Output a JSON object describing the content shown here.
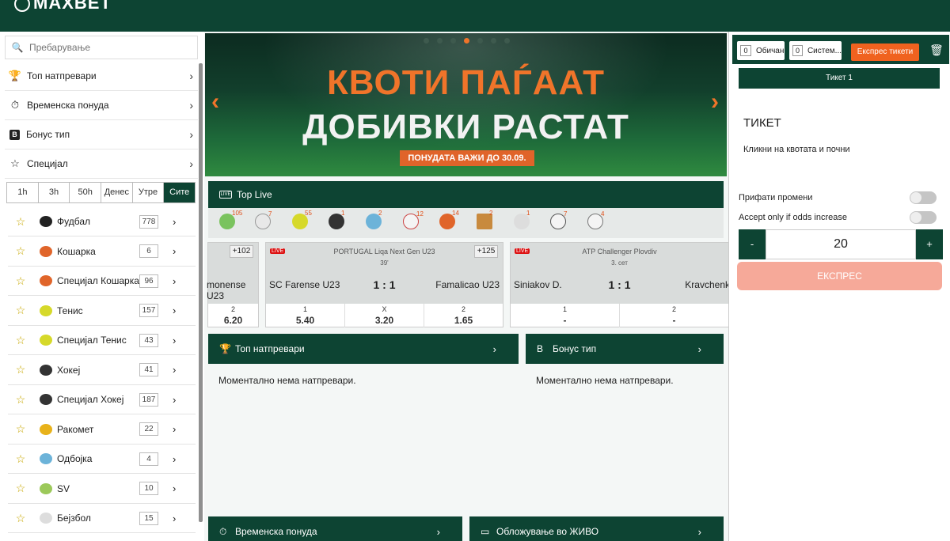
{
  "logo_text": "MAXBET",
  "search": {
    "placeholder": "Пребарување"
  },
  "menu": [
    {
      "label": "Топ натпревари",
      "icon": "trophy-icon",
      "glyph": "🏆"
    },
    {
      "label": "Временска понуда",
      "icon": "clock-icon",
      "glyph": "⏱"
    },
    {
      "label": "Бонус тип",
      "icon": "bonus-icon",
      "glyph": "B"
    },
    {
      "label": "Специјал",
      "icon": "star-icon",
      "glyph": "☆"
    }
  ],
  "time_tabs": [
    "1h",
    "3h",
    "50h",
    "Денес",
    "Утре",
    "Сите"
  ],
  "sports": [
    {
      "label": "Фудбал",
      "count": "778",
      "color": "#222222"
    },
    {
      "label": "Кошарка",
      "count": "6",
      "color": "#e0652a"
    },
    {
      "label": "Специјал Кошарка",
      "count": "96",
      "color": "#e0652a"
    },
    {
      "label": "Тенис",
      "count": "157",
      "color": "#d6d92a"
    },
    {
      "label": "Специјал Тенис",
      "count": "43",
      "color": "#d6d92a"
    },
    {
      "label": "Хокеј",
      "count": "41",
      "color": "#333333"
    },
    {
      "label": "Специјал Хокеј",
      "count": "187",
      "color": "#333333"
    },
    {
      "label": "Ракомет",
      "count": "22",
      "color": "#e8b21a"
    },
    {
      "label": "Одбојка",
      "count": "4",
      "color": "#6cb3d9"
    },
    {
      "label": "SV",
      "count": "10",
      "color": "#9cc95a"
    },
    {
      "label": "Бејзбол",
      "count": "15",
      "color": "#dddddd"
    }
  ],
  "banner": {
    "line1": "КВОТИ ПАЃААТ",
    "line2": "ДОБИВКИ РАСТАТ",
    "line3": "ПОНУДАТА ВАЖИ ДО 30.09."
  },
  "top_live": {
    "title": "Top Live",
    "live_badge": "LIVE"
  },
  "live_sport_counts": [
    "105",
    "7",
    "55",
    "1",
    "2",
    "12",
    "14",
    "2",
    "1",
    "7",
    "4"
  ],
  "matches": [
    {
      "more": "+102",
      "home": "monense U23",
      "o1": "2",
      "v1": "6.20"
    },
    {
      "league": "PORTUGAL Liqa Next Gen U23",
      "minute": "39'",
      "more": "+125",
      "home": "SC Farense U23",
      "score": "1 : 1",
      "away": "Famalicao U23",
      "o1": "1",
      "v1": "5.40",
      "o2": "X",
      "v2": "3.20",
      "o3": "2",
      "v3": "1.65"
    },
    {
      "league": "ATP Challenger Plovdiv",
      "minute": "3. сет",
      "home": "Siniakov D.",
      "score": "1 : 1",
      "away": "Kravchenk",
      "o1": "1",
      "v1": "-",
      "o2": "2",
      "v2": "-"
    }
  ],
  "sections": {
    "top": "Топ натпревари",
    "bonus": "Бонус тип",
    "time": "Временска понуда",
    "live": "Обложување во ЖИВО",
    "empty": "Моментално нема натпревари."
  },
  "ticket": {
    "tab_single_count": "0",
    "tab_single": "Обичан",
    "tab_system_count": "0",
    "tab_system": "Систем...",
    "express_tickets": "Експрес тикети",
    "ticket1": "Тикет 1",
    "title": "ТИКЕТ",
    "subtitle": "Кликни на квотата и почни",
    "accept_changes": "Прифати промени",
    "accept_increase": "Accept only if odds increase",
    "minus": "-",
    "stake": "20",
    "plus": "+",
    "express": "ЕКСПРЕС"
  },
  "colors": {
    "brand": "#0d4433",
    "accent": "#f0621f"
  }
}
